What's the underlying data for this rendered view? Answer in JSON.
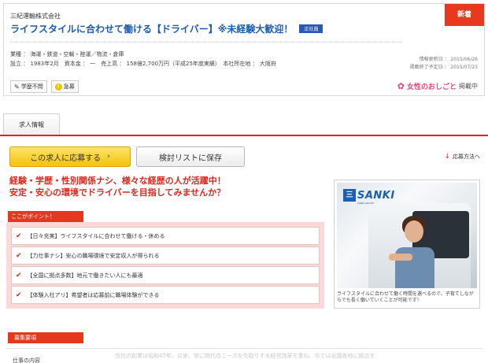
{
  "header": {
    "company": "三紀運輸株式会社",
    "job_title": "ライフスタイルに合わせて働ける【ドライバー】※未経験大歓迎！",
    "employment_badge": "正社員",
    "new_badge": "新着",
    "industry": "業種 ： 海運・鉄道・空輸・陸運／物流・倉庫",
    "founded": "設立 ： 1983年2月　資本金 ： 一　売上高 ： 158億2,700万円（平成25年度実績）　本社所在地 ： 大阪府",
    "updated": "情報更新日 ： 2015/06/26",
    "end_date": "掲載終了予定日 ： 2015/07/23",
    "tags": [
      "学歴不問",
      "急募"
    ],
    "brand_name": "女性のおしごと",
    "brand_suffix": "掲載中"
  },
  "tabs": {
    "job_info": "求人情報"
  },
  "actions": {
    "apply": "この求人に応募する",
    "save": "検討リストに保存",
    "how_to_apply": "応募方法へ"
  },
  "catch": {
    "line1": "経験・学歴・性別関係ナシ、様々な経歴の人が活躍中！",
    "line2": "安定・安心の環境でドライバーを目指してみませんか？"
  },
  "points": {
    "label": "ここがポイント！",
    "items": [
      "【日々充実】ライフスタイルに合わせて働ける・休める",
      "【力仕事ナシ】安心の職場環境で安定収入が得られる",
      "【全国に拠点多数】地元で働きたい人にも最適",
      "【体験入社アリ】希望者は応募前に職場体験ができる"
    ]
  },
  "image_panel": {
    "logo_word": "SANKI",
    "logo_sub": "SANKI GROUP",
    "caption": "ライフスタイルに合わせて働く時間を選べるので、子育てしながらでも長く働いていくことが可能です！"
  },
  "recruit": {
    "label": "募集要項",
    "key": "仕事の内容",
    "faded": "当社の創業は昭和47年。以来、常に時代のニーズを先取りする経営改革を重ね、今では全国各地に拠点を"
  }
}
